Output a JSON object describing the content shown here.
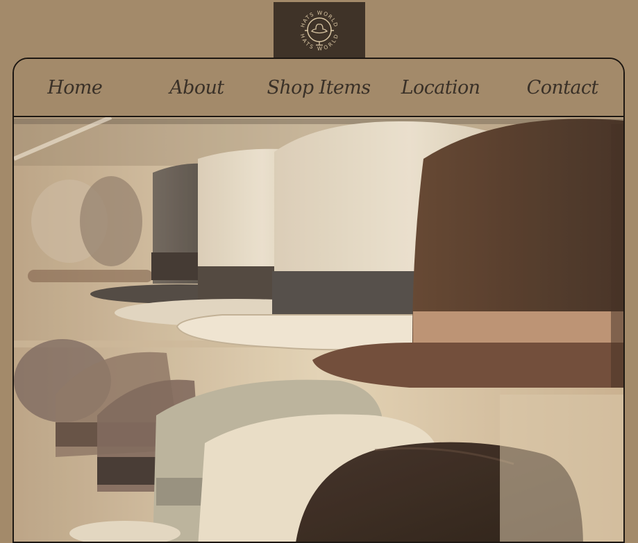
{
  "logo": {
    "text_top": "HATS WORLD",
    "text_bottom": "HATS WORLD",
    "icon": "hat-globe-logo"
  },
  "nav": {
    "items": [
      {
        "label": "Home"
      },
      {
        "label": "About"
      },
      {
        "label": "Shop Items"
      },
      {
        "label": "Location"
      },
      {
        "label": "Contact"
      }
    ]
  },
  "hero": {
    "image": "hats-on-shelves-photo"
  },
  "colors": {
    "background": "#a38a6a",
    "logo_bg": "#3f3328",
    "nav_text": "#3a3128",
    "border": "#1d1712",
    "logo_gold": "#d9c6a3"
  }
}
